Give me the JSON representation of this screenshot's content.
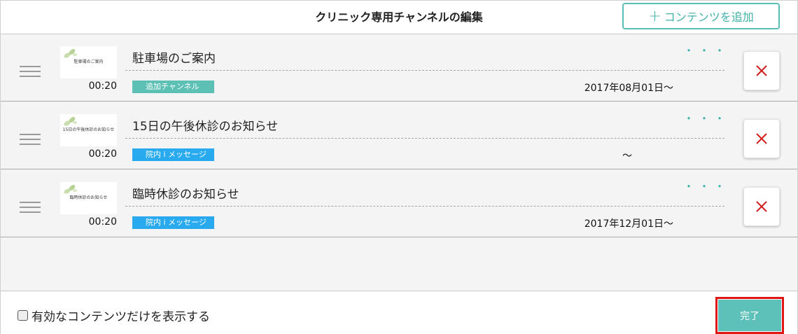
{
  "header": {
    "title": "クリニック専用チャンネルの編集",
    "add_button": {
      "plus": "+",
      "label": "コンテンツを追加"
    }
  },
  "colors": {
    "accent": "#5ec1b9",
    "badge_channel": "#5cc0b5",
    "badge_message": "#29aaee",
    "delete_x": "#d22020",
    "highlight_outline": "#e01515"
  },
  "items": [
    {
      "thumbnail_text": "駐車場のご案内",
      "duration": "00:20",
      "title": "駐車場のご案内",
      "more": "・・・",
      "badge": "追加チャンネル",
      "badge_type": "channel",
      "date": "2017年08月01日〜"
    },
    {
      "thumbnail_text": "15日の午後休診のお知らせ",
      "duration": "00:20",
      "title": "15日の午後休診のお知らせ",
      "more": "・・・",
      "badge": "院内 i メッセージ",
      "badge_type": "message",
      "date": "〜"
    },
    {
      "thumbnail_text": "臨時休診のお知らせ",
      "duration": "00:20",
      "title": "臨時休診のお知らせ",
      "more": "・・・",
      "badge": "院内 i メッセージ",
      "badge_type": "message",
      "date": "2017年12月01日〜"
    }
  ],
  "footer": {
    "checkbox_label": "有効なコンテンツだけを表示する",
    "checkbox_checked": false,
    "done_label": "完了"
  }
}
